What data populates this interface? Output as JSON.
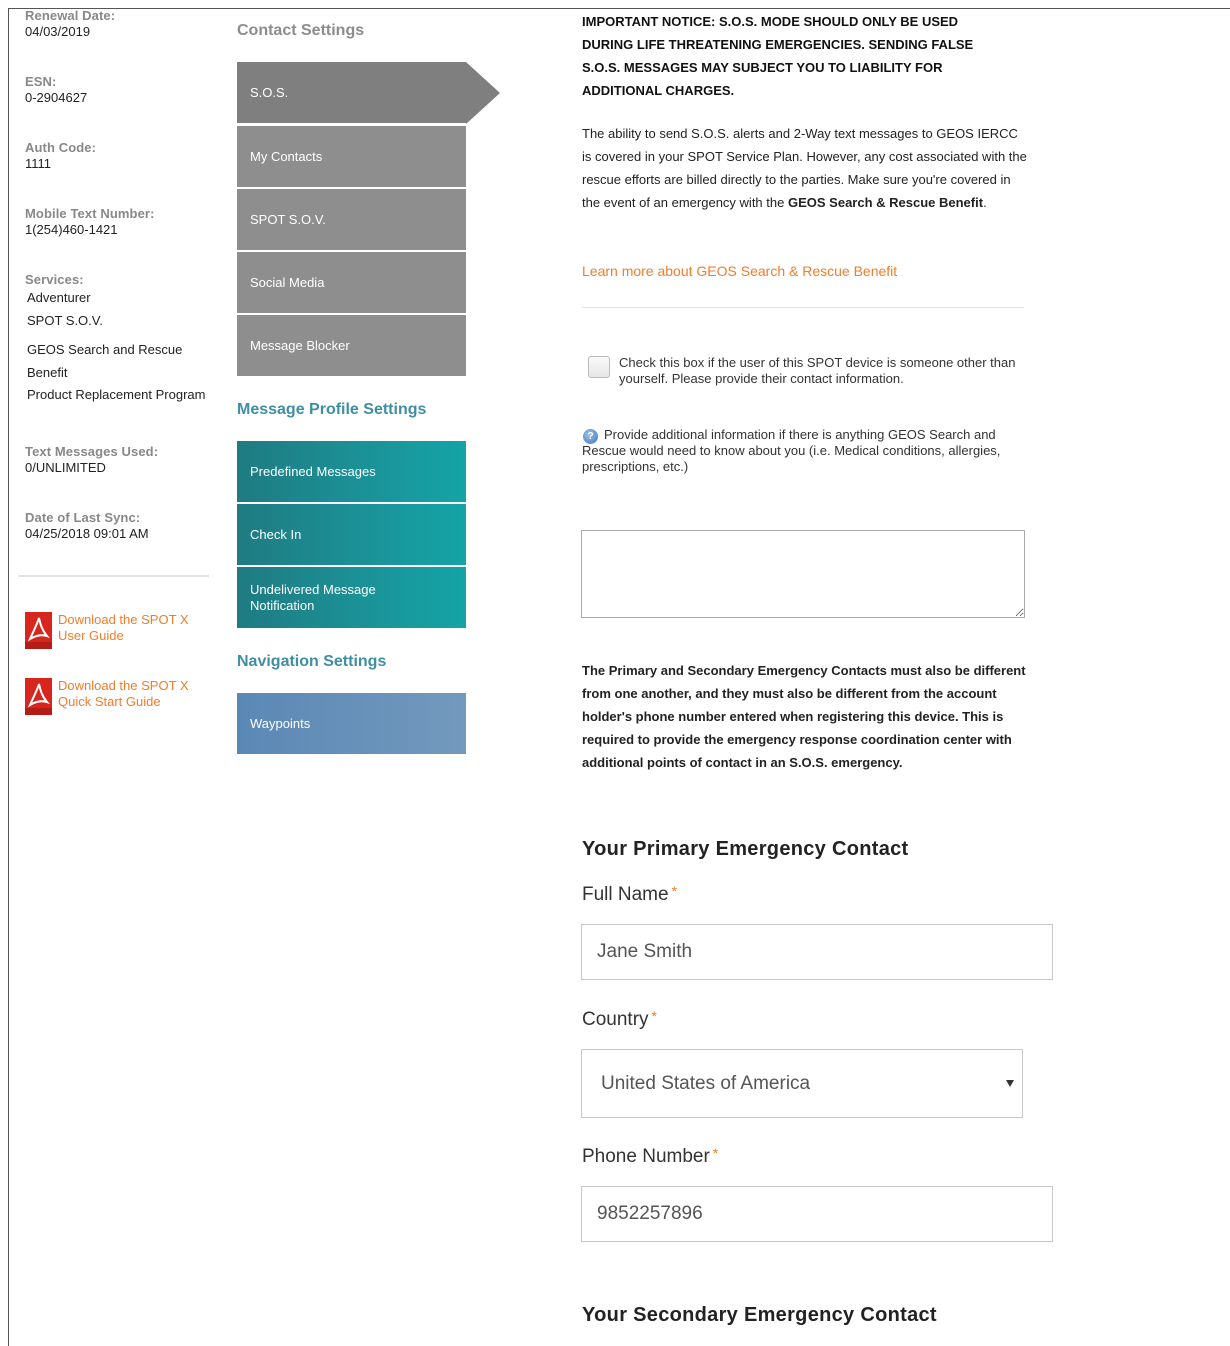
{
  "account": {
    "renewal": {
      "label": "Renewal Date:",
      "value": "04/03/2019"
    },
    "esn": {
      "label": "ESN:",
      "value": "0-2904627"
    },
    "auth": {
      "label": "Auth Code:",
      "value": "1111"
    },
    "mobile": {
      "label": "Mobile Text Number:",
      "value": "1(254)460-1421"
    },
    "services": {
      "label": "Services:",
      "items": [
        "Adventurer",
        "SPOT S.O.V.",
        "GEOS Search and Rescue Benefit",
        "Product Replacement Program"
      ]
    },
    "messages": {
      "label": "Text Messages Used:",
      "value": "0/UNLIMITED"
    },
    "sync": {
      "label": "Date of Last Sync:",
      "value": "04/25/2018 09:01 AM"
    }
  },
  "downloads": [
    {
      "label": "Download the SPOT X User Guide",
      "icon": "pdf-icon"
    },
    {
      "label": "Download the SPOT X Quick Start Guide",
      "icon": "pdf-icon"
    }
  ],
  "nav": {
    "contact_settings": "Contact Settings",
    "contact_items": [
      "S.O.S.",
      "My Contacts",
      "SPOT S.O.V.",
      "Social Media",
      "Message Blocker"
    ],
    "message_profile_settings": "Message Profile Settings",
    "message_items": [
      "Predefined Messages",
      "Check In",
      "Undelivered Message Notification"
    ],
    "navigation_settings": "Navigation Settings",
    "navigation_items": [
      "Waypoints"
    ],
    "active": "S.O.S."
  },
  "content": {
    "notice": "IMPORTANT NOTICE: S.O.S. MODE SHOULD ONLY BE USED DURING LIFE THREATENING EMERGENCIES. SENDING FALSE S.O.S. MESSAGES MAY SUBJECT YOU TO LIABILITY FOR ADDITIONAL CHARGES.",
    "ability_text": "The ability to send S.O.S. alerts and 2-Way text messages to GEOS IERCC is covered in your SPOT Service Plan. However, any cost associated with the rescue efforts are billed directly to the parties. Make sure you're covered in the event of an emergency with the",
    "ability_bold": "GEOS Search & Rescue Benefit",
    "ability_end": ".",
    "learn_more": "Learn more about GEOS Search & Rescue Benefit",
    "checkbox_text": "Check this box if the user of this SPOT device is someone other than yourself. Please provide their contact information.",
    "checkbox_checked": false,
    "additional_text": "Provide additional information if there is anything GEOS Search and Rescue would need to know about you (i.e. Medical conditions, allergies, prescriptions, etc.)",
    "additional_value": "",
    "contacts_text": "The Primary and Secondary Emergency Contacts must also be different from one another, and they must also be different from the account holder's phone number entered when registering this device. This is required to provide the emergency response coordination center with additional points of contact in an S.O.S. emergency.",
    "primary_heading": "Your Primary Emergency Contact",
    "full_name_label": "Full Name",
    "full_name_value": "Jane Smith",
    "country_label": "Country",
    "country_value": "United States of America",
    "phone_label": "Phone Number",
    "phone_value": "9852257896",
    "required_mark": "*",
    "secondary_heading": "Your Secondary Emergency Contact"
  },
  "colors": {
    "accent": "#f07d2a",
    "teal": "#1a9499",
    "nav_gray": "#8e8e8e",
    "nav_blue": "#6690ba",
    "section_teal": "#3e8fa3"
  }
}
